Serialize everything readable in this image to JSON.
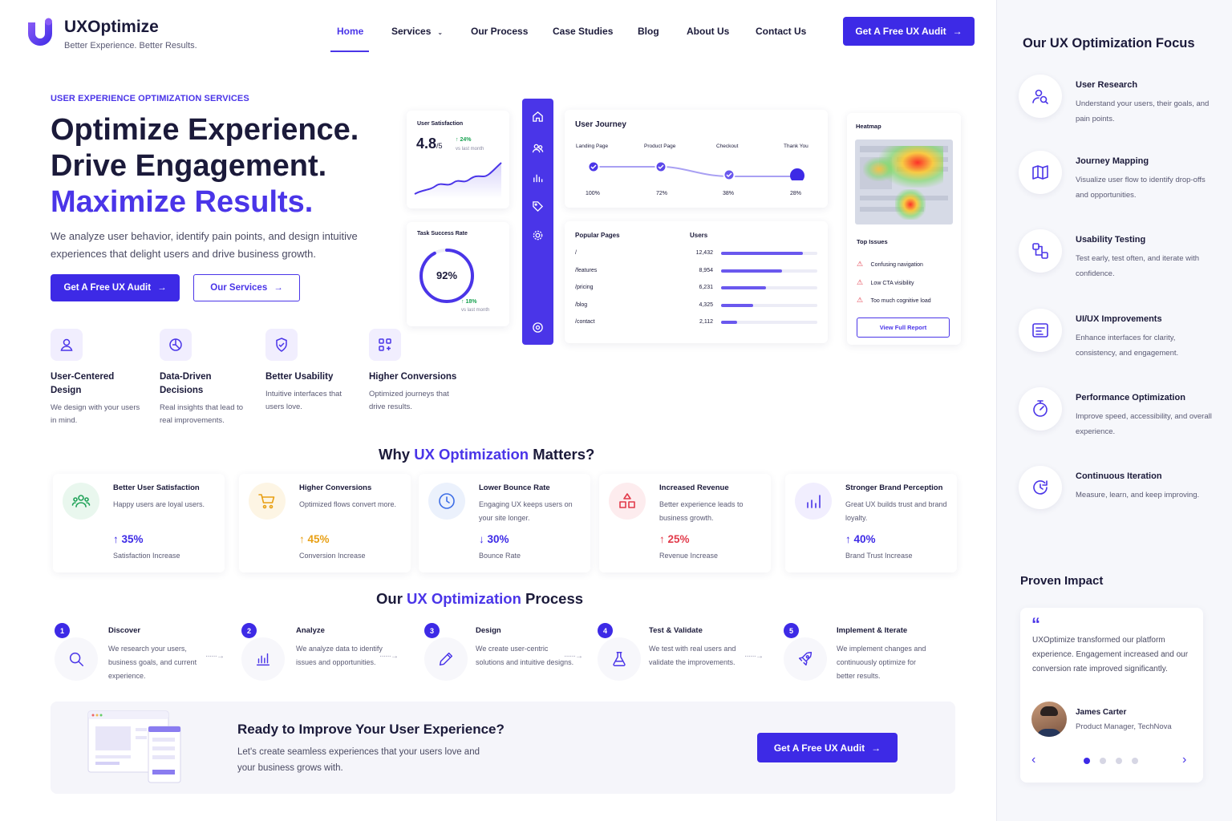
{
  "brand": {
    "name": "UXOptimize",
    "tagline": "Better Experience. Better Results."
  },
  "nav": {
    "items": [
      "Home",
      "Services",
      "Our Process",
      "Case Studies",
      "Blog",
      "About Us",
      "Contact Us"
    ],
    "active": "Home",
    "cta": "Get A Free UX Audit"
  },
  "hero": {
    "eyebrow": "USER EXPERIENCE OPTIMIZATION SERVICES",
    "line1": "Optimize Experience.",
    "line2": "Drive Engagement.",
    "line3": "Maximize Results.",
    "description": "We analyze user behavior, identify pain points, and design intuitive experiences that delight users and drive business growth.",
    "primary_cta": "Get A Free UX Audit",
    "secondary_cta": "Our Services"
  },
  "features": [
    {
      "title": "User-Centered Design",
      "desc": "We design with your users in mind.",
      "icon": "user-icon"
    },
    {
      "title": "Data-Driven Decisions",
      "desc": "Real insights that lead to real improvements.",
      "icon": "chart-pie-icon"
    },
    {
      "title": "Better Usability",
      "desc": "Intuitive interfaces that users love.",
      "icon": "shield-check-icon"
    },
    {
      "title": "Higher Conversions",
      "desc": "Optimized journeys that drive results.",
      "icon": "conversion-icon"
    }
  ],
  "dashboard": {
    "satisfaction": {
      "label": "User Satisfaction",
      "value": "4.8",
      "suffix": "/5",
      "change": "↑ 24%",
      "period": "vs last month"
    },
    "task_success": {
      "label": "Task Success Rate",
      "value": "92%",
      "progress": 0.92,
      "change": "↑ 18%",
      "period": "vs last month"
    },
    "journey": {
      "title": "User Journey",
      "steps": [
        {
          "label": "Landing Page",
          "value": "100%"
        },
        {
          "label": "Product Page",
          "value": "72%"
        },
        {
          "label": "Checkout",
          "value": "38%"
        },
        {
          "label": "Thank You",
          "value": "28%"
        }
      ]
    },
    "popular_pages": {
      "title": "Popular Pages",
      "users_header": "Users",
      "rows": [
        {
          "page": "/",
          "users": "12,432",
          "share": 0.85
        },
        {
          "page": "/features",
          "users": "8,954",
          "share": 0.63
        },
        {
          "page": "/pricing",
          "users": "6,231",
          "share": 0.47
        },
        {
          "page": "/blog",
          "users": "4,325",
          "share": 0.33
        },
        {
          "page": "/contact",
          "users": "2,112",
          "share": 0.17
        }
      ]
    },
    "heatmap": {
      "title": "Heatmap",
      "issues_title": "Top Issues",
      "issues": [
        "Confusing navigation",
        "Low CTA visibility",
        "Too much cognitive load"
      ],
      "button": "View Full Report"
    }
  },
  "why": {
    "title_pre": "Why ",
    "title_accent": "UX Optimization",
    "title_post": " Matters?",
    "cards": [
      {
        "title": "Better User Satisfaction",
        "desc": "Happy users are loyal users.",
        "value": "↑ 35%",
        "label": "Satisfaction Increase",
        "color": "#3d2ae6",
        "icon": "users-icon",
        "bg": "#e9f7ee"
      },
      {
        "title": "Higher Conversions",
        "desc": "Optimized flows convert more.",
        "value": "↑ 45%",
        "label": "Conversion Increase",
        "color": "#e8a015",
        "icon": "cart-icon",
        "bg": "#fdf5e4"
      },
      {
        "title": "Lower Bounce Rate",
        "desc": "Engaging UX keeps users on your site longer.",
        "value": "↓ 30%",
        "label": "Bounce Rate",
        "color": "#3d2ae6",
        "icon": "clock-icon",
        "bg": "#ebf1fc"
      },
      {
        "title": "Increased Revenue",
        "desc": "Better experience leads to business growth.",
        "value": "↑ 25%",
        "label": "Revenue Increase",
        "color": "#e23b4b",
        "icon": "shapes-icon",
        "bg": "#fdecee"
      },
      {
        "title": "Stronger Brand Perception",
        "desc": "Great UX builds trust and brand loyalty.",
        "value": "↑ 40%",
        "label": "Brand Trust Increase",
        "color": "#3d2ae6",
        "icon": "bar-chart-icon",
        "bg": "#f1eefe"
      }
    ]
  },
  "process": {
    "title_pre": "Our ",
    "title_accent": "UX Optimization",
    "title_post": " Process",
    "steps": [
      {
        "num": "1",
        "title": "Discover",
        "desc": "We research your users, business goals, and current experience.",
        "icon": "search-icon"
      },
      {
        "num": "2",
        "title": "Analyze",
        "desc": "We analyze data to identify issues and opportunities.",
        "icon": "analytics-icon"
      },
      {
        "num": "3",
        "title": "Design",
        "desc": "We create user-centric solutions and intuitive designs.",
        "icon": "pen-icon"
      },
      {
        "num": "4",
        "title": "Test & Validate",
        "desc": "We test with real users and validate the improvements.",
        "icon": "flask-icon"
      },
      {
        "num": "5",
        "title": "Implement & Iterate",
        "desc": "We implement changes and continuously optimize for better results.",
        "icon": "rocket-icon"
      }
    ]
  },
  "cta": {
    "title": "Ready to Improve Your User Experience?",
    "desc": "Let's create seamless experiences that your users love and your business grows with.",
    "button": "Get A Free UX Audit"
  },
  "sidebar": {
    "focus_title": "Our UX Optimization Focus",
    "focus": [
      {
        "title": "User Research",
        "desc": "Understand your users, their goals, and pain points.",
        "icon": "research-icon"
      },
      {
        "title": "Journey Mapping",
        "desc": "Visualize user flow to identify drop-offs and opportunities.",
        "icon": "map-icon"
      },
      {
        "title": "Usability Testing",
        "desc": "Test early, test often, and iterate with confidence.",
        "icon": "flow-icon"
      },
      {
        "title": "UI/UX Improvements",
        "desc": "Enhance interfaces for clarity, consistency, and engagement.",
        "icon": "layout-icon"
      },
      {
        "title": "Performance Optimization",
        "desc": "Improve speed, accessibility, and overall experience.",
        "icon": "speed-icon"
      },
      {
        "title": "Continuous Iteration",
        "desc": "Measure, learn, and keep improving.",
        "icon": "refresh-icon"
      }
    ],
    "impact_title": "Proven Impact",
    "testimonial": {
      "quote": "UXOptimize transformed our platform experience. Engagement increased and our conversion rate improved significantly.",
      "name": "James Carter",
      "role": "Product Manager, TechNova",
      "active_dot": 1,
      "dots": 4
    }
  },
  "colors": {
    "primary": "#3d2ae6",
    "accent": "#4a35e8",
    "dashboard_nav": "#4a35e8"
  }
}
